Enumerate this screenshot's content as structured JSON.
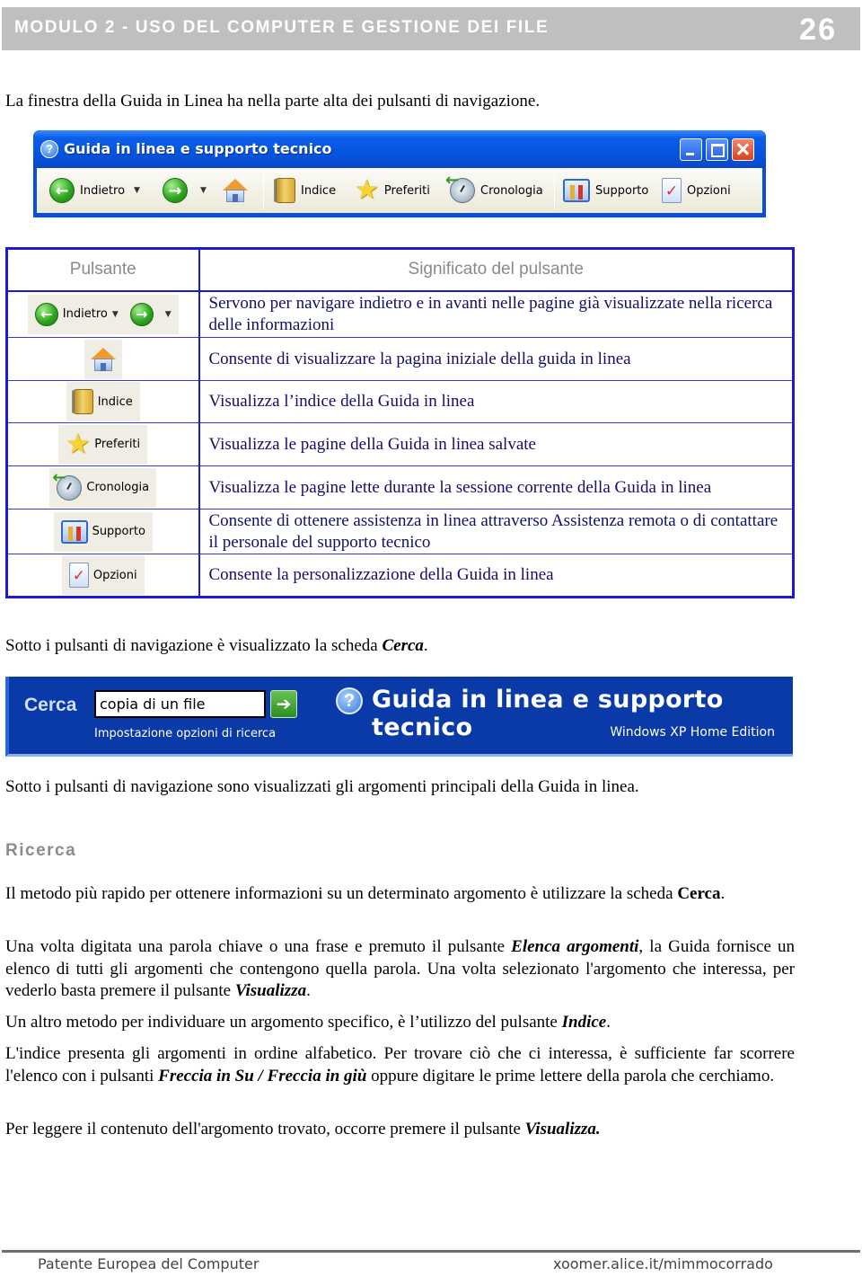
{
  "header": {
    "title": "MODULO 2 - USO DEL COMPUTER E GESTIONE DEI FILE",
    "page_number": "26"
  },
  "intro": "La finestra della Guida in Linea ha nella parte alta dei pulsanti di navigazione.",
  "help_window": {
    "title": "Guida in linea e supporto tecnico",
    "toolbar": {
      "back": "Indietro",
      "forward_icon": "forward-arrow-icon",
      "home_icon": "home-icon",
      "index": "Indice",
      "favorites": "Preferiti",
      "history": "Cronologia",
      "support": "Supporto",
      "options": "Opzioni"
    }
  },
  "table": {
    "headers": [
      "Pulsante",
      "Significato del pulsante"
    ],
    "rows": [
      {
        "button": "Indietro",
        "icon": "back-forward-icon",
        "meaning": "Servono per navigare indietro e in avanti nelle pagine già visualizzate nella ricerca delle informazioni"
      },
      {
        "button": "",
        "icon": "home-icon",
        "meaning": "Consente di visualizzare la pagina iniziale della guida in linea"
      },
      {
        "button": "Indice",
        "icon": "book-icon",
        "meaning": "Visualizza l’indice della Guida in linea"
      },
      {
        "button": "Preferiti",
        "icon": "star-icon",
        "meaning": "Visualizza le pagine della Guida in linea salvate"
      },
      {
        "button": "Cronologia",
        "icon": "history-icon",
        "meaning": "Visualizza le pagine lette durante la sessione corrente della Guida in linea"
      },
      {
        "button": "Supporto",
        "icon": "support-icon",
        "meaning": "Consente di ottenere assistenza in linea attraverso Assistenza remota o di contattare il personale del supporto tecnico"
      },
      {
        "button": "Opzioni",
        "icon": "options-icon",
        "meaning": "Consente la personalizzazione della Guida in linea"
      }
    ]
  },
  "search_intro": {
    "text": "Sotto i pulsanti di navigazione è visualizzato la scheda ",
    "emph": "Cerca",
    "end": "."
  },
  "search_bar": {
    "label": "Cerca",
    "input_value": "copia di un file",
    "options_link": "Impostazione opzioni di ricerca",
    "banner_title": "Guida in linea e supporto tecnico",
    "edition": "Windows XP Home Edition"
  },
  "topics_para": "Sotto i pulsanti di navigazione sono visualizzati gli argomenti principali della Guida in linea.",
  "section": {
    "title": "Ricerca",
    "p1": {
      "text": "Il metodo più rapido per ottenere informazioni su un determinato argomento è utilizzare la scheda ",
      "bold": "Cerca",
      "end": "."
    },
    "p2": {
      "a": "Una volta digitata una parola chiave o una frase e premuto il pulsante ",
      "e1": "Elenca argomenti",
      "b": ", la Guida fornisce un elenco di tutti gli argomenti che contengono quella parola. Una volta selezionato l'argomento che interessa, per vederlo basta premere il pulsante ",
      "e2": "Visualizza",
      "c": "."
    },
    "p3": {
      "a": "Un altro metodo per individuare un argomento specifico, è l’utilizzo del pulsante ",
      "e1": "Indice",
      "b": "."
    },
    "p4": {
      "a": "L'indice presenta gli argomenti in ordine alfabetico. Per trovare ciò che ci interessa, è sufficiente far scorrere l'elenco con i pulsanti ",
      "e1": "Freccia in Su / Freccia in giù",
      "b": " oppure digitare le prime lettere della parola che cerchiamo."
    },
    "p5": {
      "a": "Per leggere il contenuto dell'argomento trovato, occorre premere il pulsante ",
      "e1": "Visualizza.",
      "b": ""
    }
  },
  "footer": {
    "left": "Patente Europea del Computer",
    "right": "xoomer.alice.it/mimmocorrado"
  }
}
